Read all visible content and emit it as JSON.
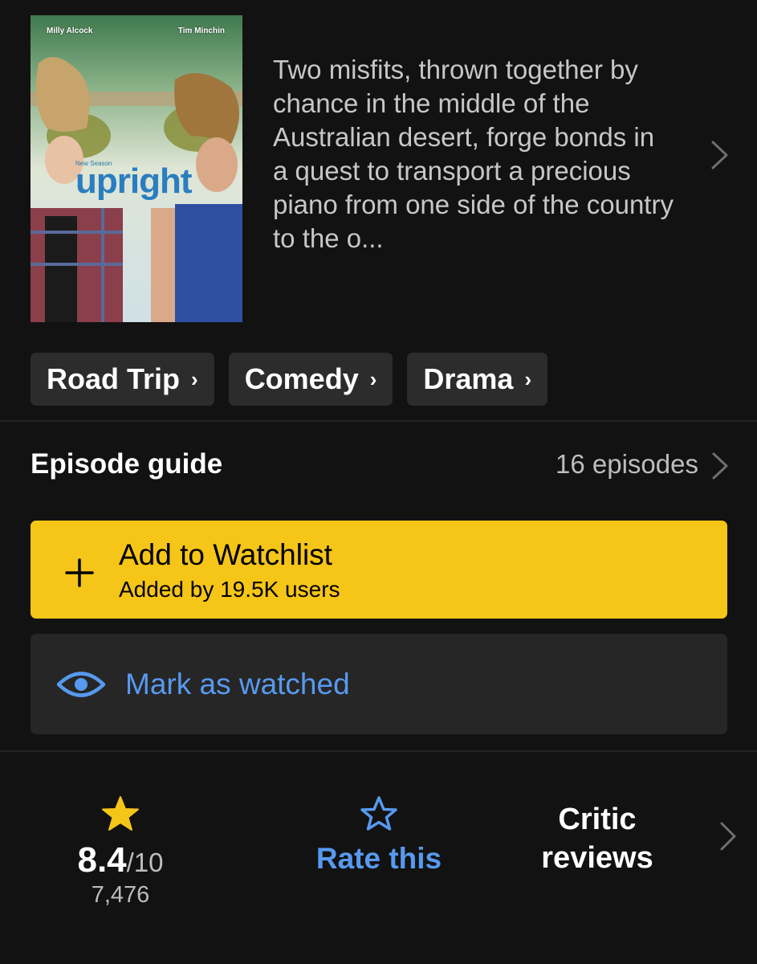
{
  "poster": {
    "actor_left": "Milly Alcock",
    "actor_right": "Tim Minchin",
    "season_tag": "New Season",
    "show_title": "upright"
  },
  "description": "Two misfits, thrown together by chance in the middle of the Australian desert, forge bonds in a quest to transport a precious piano from one side of the country to the o...",
  "genres": [
    {
      "label": "Road Trip",
      "chevron": "›"
    },
    {
      "label": "Comedy",
      "chevron": "›"
    },
    {
      "label": "Drama",
      "chevron": "›"
    }
  ],
  "episode_guide": {
    "title": "Episode guide",
    "count": "16 episodes"
  },
  "watchlist": {
    "label": "Add to Watchlist",
    "subtext": "Added by 19.5K users",
    "color": "#f5c518"
  },
  "watched": {
    "label": "Mark as watched",
    "color": "#5799ef"
  },
  "rating": {
    "value": "8.4",
    "scale": "/10",
    "count": "7,476",
    "star_color": "#f5c518"
  },
  "rate_this": {
    "label": "Rate this"
  },
  "critic_reviews": {
    "line1": "Critic",
    "line2": "reviews"
  },
  "icons": {
    "chevron": "chevron-right-icon",
    "plus": "plus-icon",
    "eye": "eye-icon",
    "star_filled": "star-filled-icon",
    "star_outline": "star-outline-icon"
  }
}
